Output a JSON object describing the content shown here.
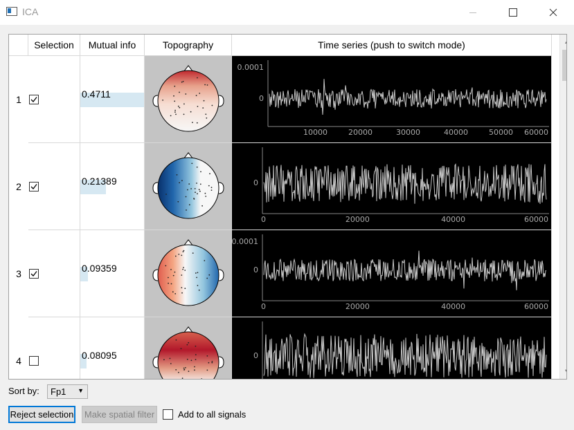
{
  "window": {
    "title": "ICA"
  },
  "columns": [
    "Selection",
    "Mutual info",
    "Topography",
    "Time series (push to switch mode)"
  ],
  "rows": [
    {
      "index": "1",
      "selected": true,
      "mutual_info": "0.4711",
      "mi_fraction": 1.0,
      "y_ticks": [
        "0.0001",
        "0"
      ],
      "x_ticks": [
        "10000",
        "20000",
        "30000",
        "40000",
        "50000",
        "60000"
      ]
    },
    {
      "index": "2",
      "selected": true,
      "mutual_info": "0.21389",
      "mi_fraction": 0.4,
      "y_ticks": [
        "0"
      ],
      "x_ticks": [
        "0",
        "20000",
        "40000",
        "60000"
      ]
    },
    {
      "index": "3",
      "selected": true,
      "mutual_info": "0.09359",
      "mi_fraction": 0.12,
      "y_ticks": [
        "0.0001",
        "0"
      ],
      "x_ticks": [
        "0",
        "20000",
        "40000",
        "60000"
      ]
    },
    {
      "index": "4",
      "selected": false,
      "mutual_info": "0.08095",
      "mi_fraction": 0.1,
      "y_ticks": [
        "0"
      ],
      "x_ticks": []
    }
  ],
  "controls": {
    "sort_label": "Sort by:",
    "sort_value": "Fp1",
    "reject_button": "Reject selection",
    "spatial_button": "Make spatial filter",
    "add_all_label": "Add to all signals"
  },
  "colors": {
    "accent": "#0078d7",
    "mi_bar": "#d6e8f2",
    "trace": "#c8c8c8",
    "topo_red": "#b2182b",
    "topo_blue": "#2166ac"
  },
  "icons": {
    "minimize": "minimize-icon",
    "maximize": "maximize-icon",
    "close": "close-icon",
    "dropdown": "chevron-down-icon"
  }
}
